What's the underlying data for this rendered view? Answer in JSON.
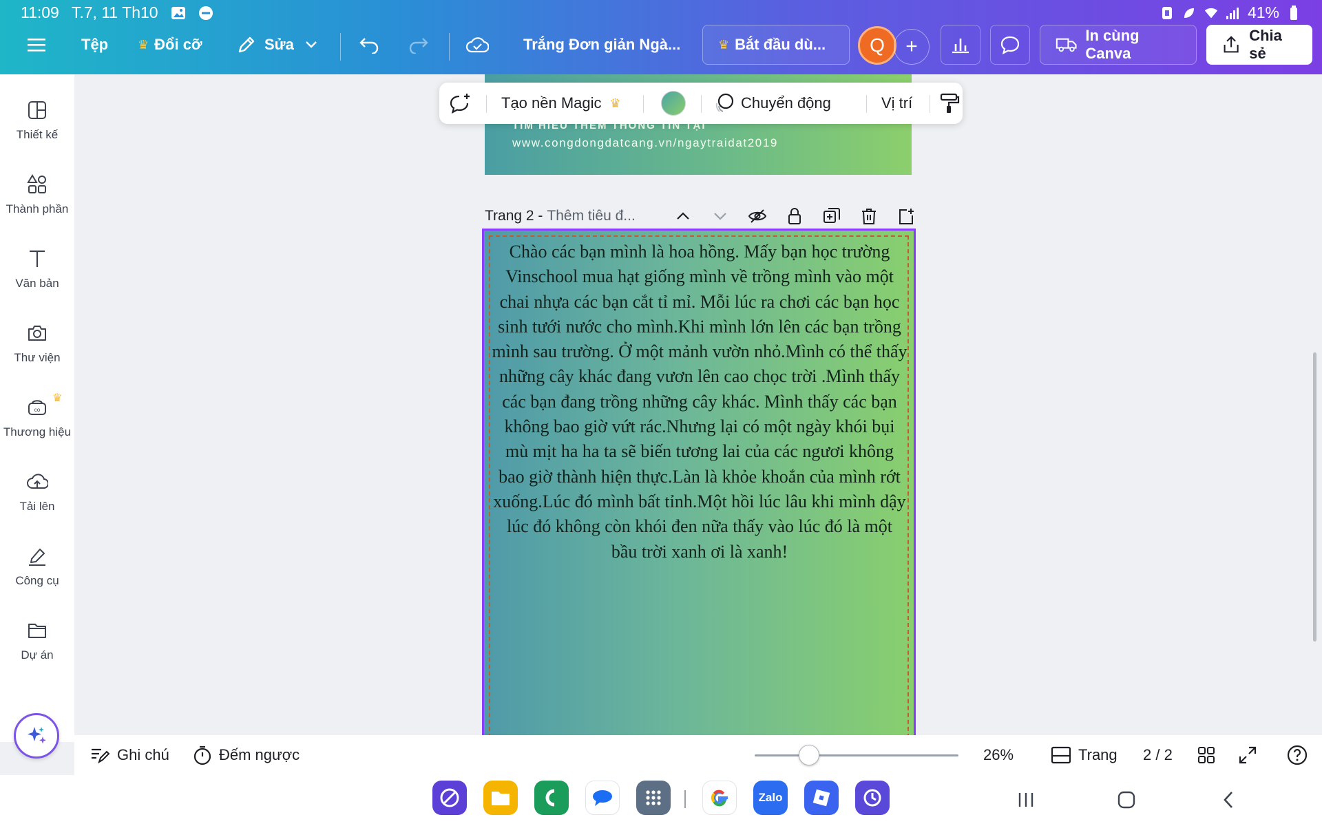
{
  "status_bar": {
    "time": "11:09",
    "date": "T.7, 11 Th10",
    "battery": "41%"
  },
  "toolbar": {
    "menu_icon": "hamburger-icon",
    "file_label": "Tệp",
    "resize_label": "Đổi cỡ",
    "edit_label": "Sửa",
    "doc_title": "Trắng Đơn giản Ngà...",
    "trial_label": "Bắt đầu dù...",
    "avatar_letter": "Q",
    "print_label": "In cùng Canva",
    "share_label": "Chia sẻ"
  },
  "sidebar": {
    "items": [
      {
        "label": "Thiết kế",
        "icon": "layout-icon"
      },
      {
        "label": "Thành phần",
        "icon": "shapes-icon"
      },
      {
        "label": "Văn bản",
        "icon": "text-icon"
      },
      {
        "label": "Thư viện",
        "icon": "camera-icon"
      },
      {
        "label": "Thương hiệu",
        "icon": "brand-icon"
      },
      {
        "label": "Tải lên",
        "icon": "cloud-upload-icon"
      },
      {
        "label": "Công cụ",
        "icon": "pen-tool-icon"
      },
      {
        "label": "Dự án",
        "icon": "folder-icon"
      }
    ]
  },
  "context_bar": {
    "magic_bg_label": "Tạo nền Magic",
    "animate_label": "Chuyển động",
    "position_label": "Vị trí"
  },
  "page1": {
    "line1": "TÌM HIỂU THÊM THÔNG TIN TẠI",
    "line2": "www.congdongdatcang.vn/ngaytraidat2019"
  },
  "page2": {
    "label": "Trang 2 -",
    "title_placeholder": "Thêm tiêu đ...",
    "body_text": "Chào các bạn mình là hoa hồng. Mấy bạn học trường Vinschool mua hạt giống mình về trồng mình vào một chai nhựa các bạn cắt tỉ mỉ. Mỗi lúc ra chơi các bạn học sinh tưới nước cho mình.Khi mình lớn lên các bạn trồng mình sau trường. Ở một  mảnh vườn nhỏ.Mình có thể thấy những cây khác đang vươn lên cao chọc trời .Mình thấy các bạn đang  trồng những cây khác. Mình thấy các bạn không bao giờ vứt rác.Nhưng lại có một ngày khói bụi mù mịt ha ha ta sẽ biến tương lai của các ngươi không bao giờ thành hiện thực.Làn là khỏe khoắn của mình rớt xuống.Lúc đó mình bất tỉnh.Một hồi lúc lâu khi mình dậy lúc đó không còn khói đen nữa thấy vào lúc đó là một bầu trời xanh ơi là xanh!"
  },
  "bottom_bar": {
    "notes_label": "Ghi chú",
    "timer_label": "Đếm ngược",
    "zoom": "26%",
    "pages_label": "Trang",
    "page_count": "2 / 2",
    "zoom_fraction": 0.26
  },
  "dock": {
    "apps": [
      {
        "name": "browser-app-icon",
        "color": "#5b3fd6"
      },
      {
        "name": "files-app-icon",
        "color": "#f4b400"
      },
      {
        "name": "phone-app-icon",
        "color": "#1a9c5a"
      },
      {
        "name": "messages-app-icon",
        "color": "#ffffff"
      },
      {
        "name": "app-drawer-icon",
        "color": "#5d6f84"
      },
      {
        "name": "google-app-icon",
        "color": "#ffffff"
      },
      {
        "name": "zalo-app-icon",
        "color": "#2b6cf0",
        "text": "Zalo"
      },
      {
        "name": "roblox-app-icon",
        "color": "#3a64f0"
      },
      {
        "name": "clock-app-icon",
        "color": "#5a48d8"
      }
    ]
  },
  "colors": {
    "accent": "#8b3dff",
    "header_start": "#1fb6c8",
    "header_end": "#7b3fe4",
    "crown": "#f7c948"
  }
}
